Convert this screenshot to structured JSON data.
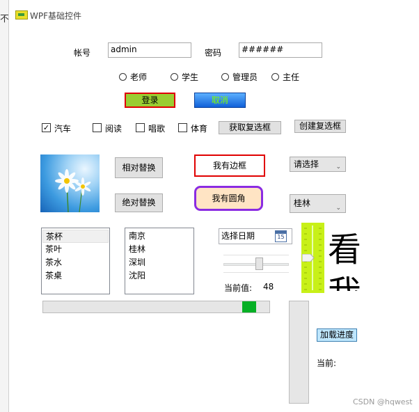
{
  "background": {
    "partial_char": "不"
  },
  "window": {
    "title": "WPF基础控件"
  },
  "login": {
    "account_label": "帐号",
    "account_value": "admin",
    "password_label": "密码",
    "password_value": "######"
  },
  "roles": [
    "老师",
    "学生",
    "管理员",
    "主任"
  ],
  "buttons": {
    "login": "登录",
    "cancel": "取消",
    "get_checkboxes": "获取复选框",
    "create_checkboxes": "创建复选框",
    "relative_replace": "相对替换",
    "absolute_replace": "绝对替换",
    "border_text": "我有边框",
    "round_text": "我有圆角",
    "load_progress": "加载进度"
  },
  "hobbies": [
    {
      "label": "汽车",
      "checked": true
    },
    {
      "label": "阅读",
      "checked": false
    },
    {
      "label": "唱歌",
      "checked": false
    },
    {
      "label": "体育",
      "checked": false
    }
  ],
  "combos": {
    "first": "请选择",
    "second": "桂林"
  },
  "list1": [
    "茶杯",
    "茶叶",
    "茶水",
    "茶桌"
  ],
  "list2": [
    "南京",
    "桂林",
    "深圳",
    "沈阳"
  ],
  "date_picker": {
    "placeholder": "选择日期",
    "calendar_day": "15"
  },
  "slider": {
    "label": "当前值:",
    "value": "48",
    "fraction": 0.48
  },
  "vertical_slider": {
    "fraction": 0.5
  },
  "big_text": {
    "line1": "看",
    "line2": "我"
  },
  "progress": {
    "fraction": 0.94
  },
  "current_label": "当前:",
  "watermark": "CSDN @hqwest",
  "colors": {
    "login_button_bg": "#9acd32",
    "login_button_border": "#e00000",
    "cancel_button_bg": "#1e90ff",
    "cancel_text": "#7fff00",
    "border_box": "#e00000",
    "round_box_border": "#8a2be2",
    "round_box_bg": "#ffe4c4",
    "yellowgreen": "#c8f018",
    "progress_fill": "#06b025"
  }
}
